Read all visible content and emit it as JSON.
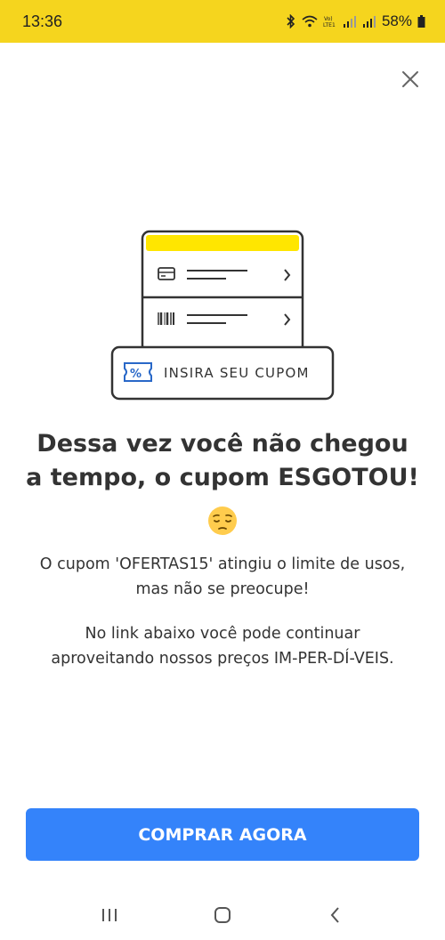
{
  "status_bar": {
    "time": "13:36",
    "battery": "58%"
  },
  "illustration": {
    "coupon_label": "INSIRA SEU CUPOM"
  },
  "modal": {
    "title_line1": "Dessa vez você não chegou",
    "title_line2": "a tempo, o cupom ESGOTOU!",
    "emoji": "pensive-face",
    "message1_line1": "O cupom 'OFERTAS15' atingiu o limite de usos,",
    "message1_line2": "mas não se preocupe!",
    "message2_line1": "No link abaixo você pode continuar",
    "message2_line2": "aproveitando nossos preços IM-PER-DÍ-VEIS."
  },
  "cta": {
    "label": "COMPRAR AGORA"
  },
  "colors": {
    "status_bar": "#f5d51e",
    "accent_yellow": "#ffe600",
    "cta_blue": "#3483fa",
    "text": "#333333"
  }
}
